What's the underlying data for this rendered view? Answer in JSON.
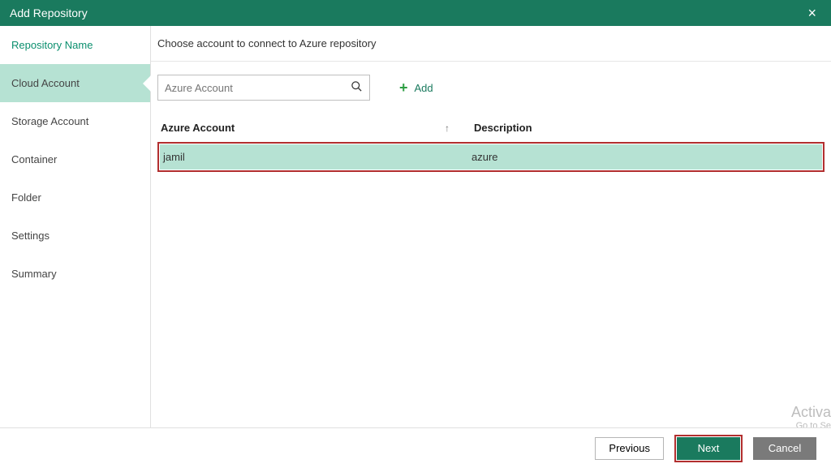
{
  "titlebar": {
    "title": "Add Repository"
  },
  "sidebar": {
    "items": [
      {
        "label": "Repository Name",
        "primary": true
      },
      {
        "label": "Cloud Account",
        "active": true
      },
      {
        "label": "Storage Account"
      },
      {
        "label": "Container"
      },
      {
        "label": "Folder"
      },
      {
        "label": "Settings"
      },
      {
        "label": "Summary"
      }
    ]
  },
  "header": {
    "instruction": "Choose account to connect to Azure repository"
  },
  "toolbar": {
    "search_placeholder": "Azure Account",
    "add_label": "Add"
  },
  "table": {
    "col_account": "Azure Account",
    "col_description": "Description",
    "rows": [
      {
        "account": "jamil",
        "description": "azure"
      }
    ]
  },
  "footer": {
    "previous": "Previous",
    "next": "Next",
    "cancel": "Cancel"
  },
  "watermark": {
    "line1": "Activa",
    "line2": "Go to Se"
  }
}
